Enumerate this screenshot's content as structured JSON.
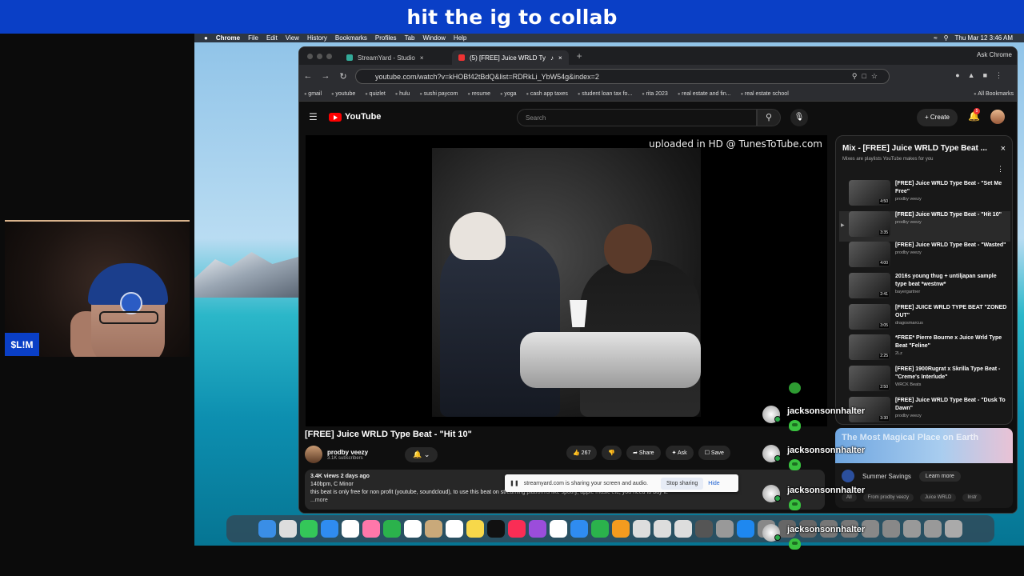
{
  "banner": {
    "text": "hit the ig to collab"
  },
  "webcam": {
    "name": "$L!M"
  },
  "menubar": {
    "apple": "",
    "app": "Chrome",
    "items": [
      "File",
      "Edit",
      "View",
      "History",
      "Bookmarks",
      "Profiles",
      "Tab",
      "Window",
      "Help"
    ],
    "datetime": "Thu Mar 12  3:46 AM"
  },
  "browser": {
    "tabs": [
      {
        "label": "StreamYard - Studio"
      },
      {
        "label": "(5) [FREE] Juice WRLD Ty"
      }
    ],
    "ask_chrome": "Ask Chrome",
    "url": "youtube.com/watch?v=kHOBf42tBdQ&list=RDRkLi_YbW54g&index=2",
    "bookmarks": [
      "gmail",
      "youtube",
      "quizlet",
      "hulu",
      "sushi paycom",
      "resume",
      "yoga",
      "cash app taxes",
      "student loan tax fo...",
      "rita 2023",
      "real estate and fin...",
      "real estate school"
    ],
    "all_bookmarks": "All Bookmarks"
  },
  "youtube": {
    "logo": "YouTube",
    "search_placeholder": "Search",
    "create_label": "Create",
    "notif_count": "5",
    "video_caption": "uploaded in HD @ TunesToTube.com",
    "title": "[FREE] Juice WRLD Type Beat - \"Hit 10\"",
    "channel": "prodby veezy",
    "subscribers": "3.1K subscribers",
    "likes": "267",
    "actions": {
      "share": "Share",
      "ask": "Ask",
      "save": "Save"
    },
    "description": {
      "stats": "3.4K views  2 days ago",
      "line1": "140bpm, C Minor",
      "line2": "this beat is only free for non profit (youtube, soundcloud), to use this beat on streaming platforms like spotify, apple music etc, you need to buy it.",
      "more": "...more"
    },
    "playlist": {
      "title": "Mix - [FREE] Juice WRLD Type Beat ...",
      "subtitle": "Mixes are playlists YouTube makes for you",
      "items": [
        {
          "title": "[FREE] Juice WRLD Type Beat - \"Set Me Free\"",
          "author": "prodby veezy",
          "duration": "4:50"
        },
        {
          "title": "[FREE] Juice WRLD Type Beat - \"Hit 10\"",
          "author": "prodby veezy",
          "duration": "3:35"
        },
        {
          "title": "[FREE] Juice WRLD Type Beat - \"Wasted\"",
          "author": "prodby veezy",
          "duration": "4:00"
        },
        {
          "title": "2016s young thug + untiljapan sample type beat *westnw*",
          "author": "bayergartner",
          "duration": "2:41"
        },
        {
          "title": "[FREE] JUICE WRLD TYPE BEAT \"ZONED OUT\"",
          "author": "dragosmarcus",
          "duration": "3:05"
        },
        {
          "title": "*FREE* Pierre Bourne x Juice Wrld Type Beat \"Feline\"",
          "author": "2Lz",
          "duration": "2:25"
        },
        {
          "title": "[FREE] 1900Rugrat x Skrilla Type Beat - \"Creme's Interlude\"",
          "author": "WRCK Beats",
          "duration": "2:50"
        },
        {
          "title": "[FREE] Juice WRLD Type Beat - \"Dusk To Dawn\"",
          "author": "prodby veezy",
          "duration": "3:30"
        }
      ]
    },
    "ad": {
      "banner": "The Most Magical Place on Earth",
      "title": "Summer Savings",
      "learn_more": "Learn more",
      "chips": [
        "All",
        "From prodby veezy",
        "Juice WRLD",
        "Instr"
      ]
    }
  },
  "share_bar": {
    "message": "streamyard.com is sharing your screen and audio.",
    "stop": "Stop sharing",
    "hide": "Hide"
  },
  "chat": [
    {
      "user": "jacksonsonnhalter"
    },
    {
      "user": "jacksonsonnhalter"
    },
    {
      "user": "jacksonsonnhalter"
    },
    {
      "user": "jacksonsonnhalter"
    }
  ]
}
